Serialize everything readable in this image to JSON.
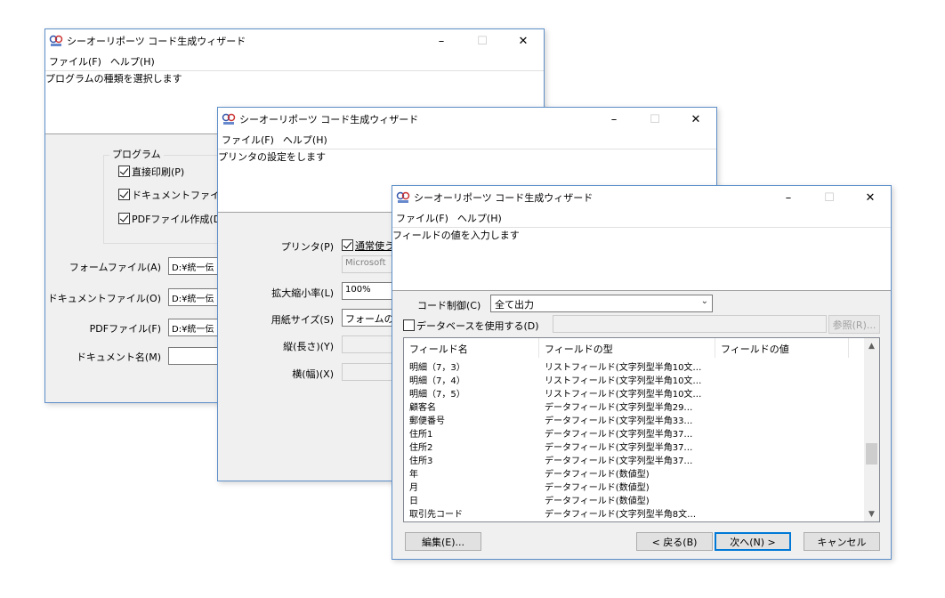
{
  "app_title": "シーオーリポーツ コード生成ウィザード",
  "window_buttons": {
    "minimize": "–",
    "maximize": "☐",
    "close": "✕"
  },
  "menu": {
    "file": "ファイル(F)",
    "help": "ヘルプ(H)"
  },
  "win1": {
    "header": "プログラムの種類を選択します",
    "group_title": "プログラム",
    "checks": [
      {
        "label": "直接印刷(P)",
        "checked": true
      },
      {
        "label": "ドキュメントファイル",
        "checked": true
      },
      {
        "label": "PDFファイル作成(D",
        "checked": true
      }
    ],
    "fields": [
      {
        "label": "フォームファイル(A)",
        "value": "D:¥統一伝"
      },
      {
        "label": "ドキュメントファイル(O)",
        "value": "D:¥統一伝"
      },
      {
        "label": "PDFファイル(F)",
        "value": "D:¥統一伝"
      },
      {
        "label": "ドキュメント名(M)",
        "value": ""
      }
    ]
  },
  "win2": {
    "header": "プリンタの設定をします",
    "printer_label": "プリンタ(P)",
    "printer_check": "通常使う",
    "printer_name": "Microsoft",
    "zoom_label": "拡大縮小率(L)",
    "zoom_value": "100%",
    "paper_label": "用紙サイズ(S)",
    "paper_value": "フォームの",
    "height_label": "縦(長さ)(Y)",
    "width_label": "横(幅)(X)"
  },
  "win3": {
    "header": "フィールドの値を入力します",
    "code_control_label": "コード制御(C)",
    "code_control_value": "全て出力",
    "use_db_label": "データベースを使用する(D)",
    "browse_button": "参照(R)...",
    "columns": [
      "フィールド名",
      "フィールドの型",
      "フィールドの値"
    ],
    "rows": [
      [
        "明細（7，3）",
        "リストフィールド(文字列型半角10文…",
        ""
      ],
      [
        "明細（7，4）",
        "リストフィールド(文字列型半角10文…",
        ""
      ],
      [
        "明細（7，5）",
        "リストフィールド(文字列型半角10文…",
        ""
      ],
      [
        "顧客名",
        "データフィールド(文字列型半角29…",
        ""
      ],
      [
        "郵便番号",
        "データフィールド(文字列型半角33…",
        ""
      ],
      [
        "住所1",
        "データフィールド(文字列型半角37…",
        ""
      ],
      [
        "住所2",
        "データフィールド(文字列型半角37…",
        ""
      ],
      [
        "住所3",
        "データフィールド(文字列型半角37…",
        ""
      ],
      [
        "年",
        "データフィールド(数値型)",
        ""
      ],
      [
        "月",
        "データフィールド(数値型)",
        ""
      ],
      [
        "日",
        "データフィールド(数値型)",
        ""
      ],
      [
        "取引先コード",
        "データフィールド(文字列型半角8文…",
        ""
      ]
    ],
    "buttons": {
      "edit": "編集(E)...",
      "back": "< 戻る(B)",
      "next": "次へ(N) >",
      "cancel": "キャンセル"
    }
  }
}
